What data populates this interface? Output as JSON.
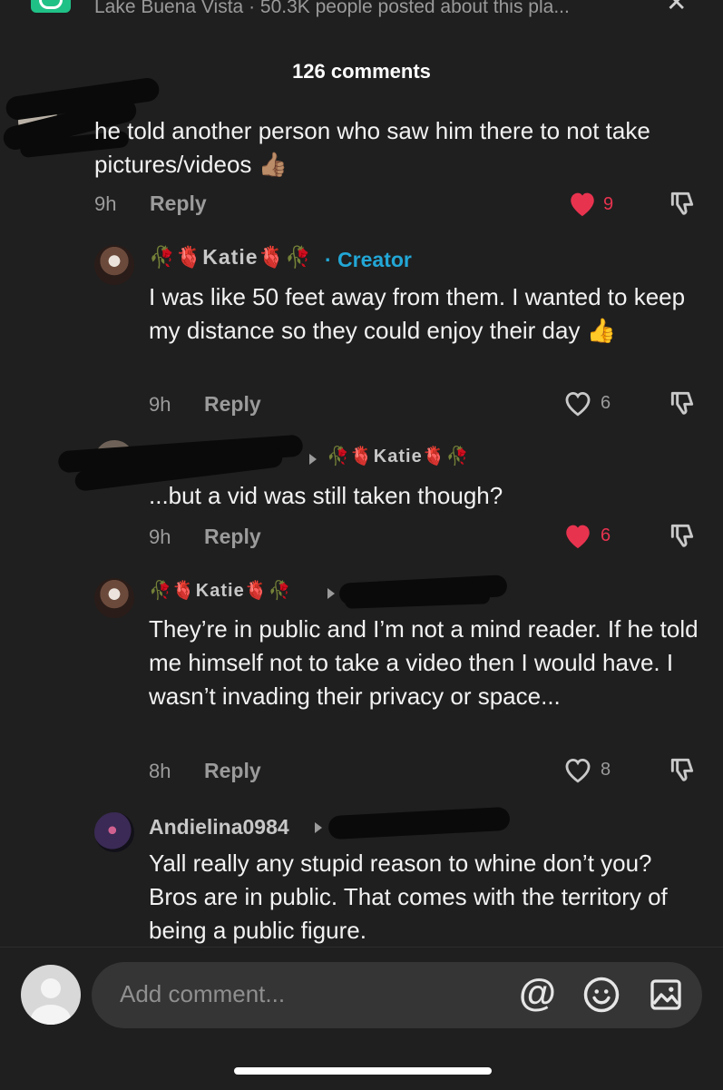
{
  "header": {
    "location_text": "Lake Buena Vista · 50.3K people posted about this pla...",
    "close_glyph": "✕",
    "comments_count": "126 comments"
  },
  "comments": [
    {
      "text": "he told another person who saw him there to not take pictures/videos 👍🏽",
      "time": "9h",
      "reply_label": "Reply",
      "likes": "9",
      "liked": true
    },
    {
      "username": "🥀🫀Katie🫀🥀",
      "creator_label": "· Creator",
      "text": "I was like 50 feet away from them. I wanted to keep my distance so they could enjoy their day 👍",
      "time": "9h",
      "reply_label": "Reply",
      "likes": "6",
      "liked": false
    },
    {
      "reply_to": "🥀🫀Katie🫀🥀",
      "text": "...but a vid was still taken though?",
      "time": "9h",
      "reply_label": "Reply",
      "likes": "6",
      "liked": true
    },
    {
      "username": "🥀🫀Katie🫀🥀",
      "text": "They’re in public and I’m not a mind reader. If he told me himself not to take a video then I would have. I wasn’t invading their privacy or space...",
      "time": "8h",
      "reply_label": "Reply",
      "likes": "8",
      "liked": false
    },
    {
      "username": "Andielina0984",
      "text": "Yall really any stupid reason to whine don’t you? Bros are in public. That comes with the territory of being a public figure."
    }
  ],
  "composer": {
    "placeholder": "Add comment...",
    "mention_icon": "@"
  },
  "colors": {
    "background": "#1f1f1f",
    "like_red": "#e8334f",
    "creator_blue": "#22a7d6",
    "input_bg": "#353535"
  }
}
